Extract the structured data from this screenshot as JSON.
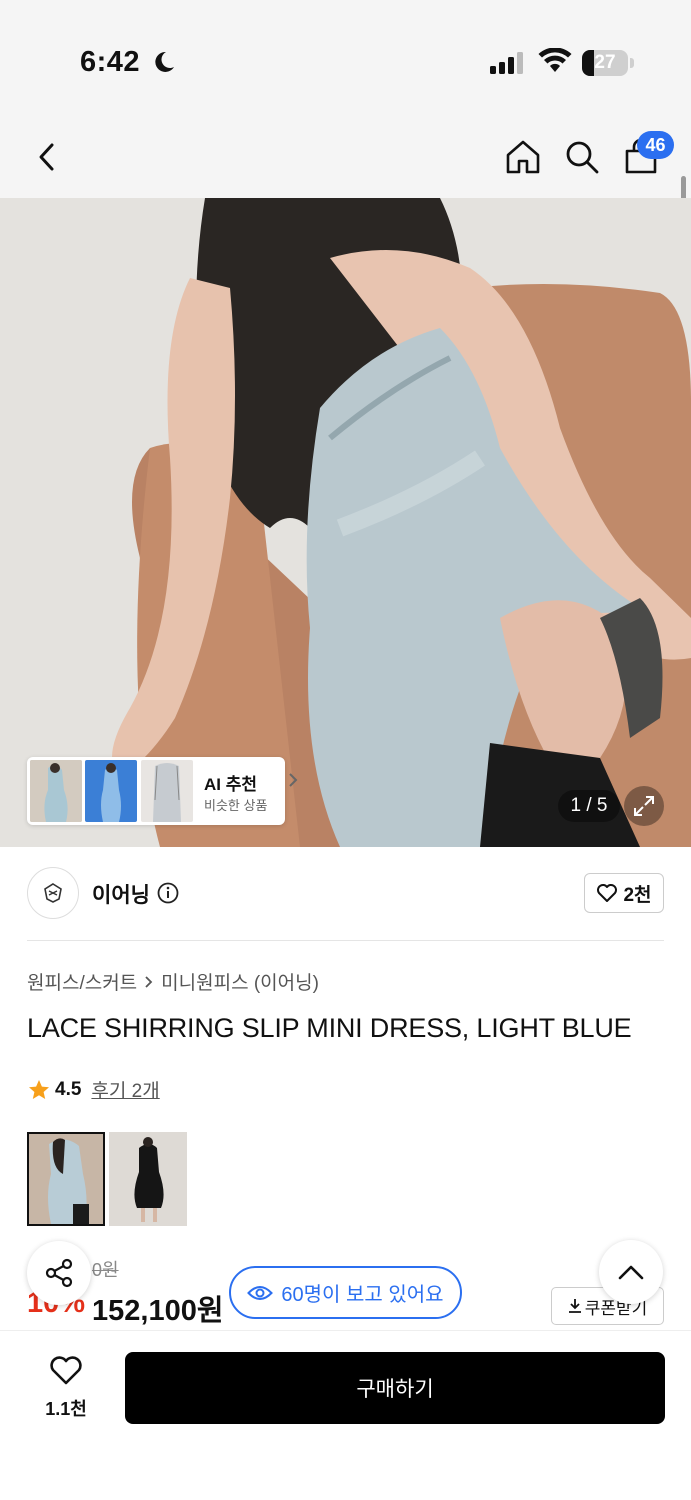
{
  "status_bar": {
    "time": "6:42",
    "battery": "27",
    "battery_level": 0.27
  },
  "nav": {
    "cart_count": "46",
    "icons": [
      "back-icon",
      "home-icon",
      "search-icon",
      "cart-icon"
    ]
  },
  "hero": {
    "counter": "1 / 5",
    "ai_card": {
      "title": "AI 추천",
      "subtitle": "비슷한 상품"
    }
  },
  "brand": {
    "name": "이어닝",
    "likes": "2천"
  },
  "breadcrumb": [
    "원피스/스커트",
    "미니원피스 (이어닝)"
  ],
  "product": {
    "title": "LACE SHIRRING SLIP MINI DRESS, LIGHT BLUE",
    "rating": "4.5",
    "reviews": "후기 2개",
    "price_original": "0원",
    "discount": "10%",
    "price": "152,100원"
  },
  "viewers": "60명이 보고 있어요",
  "coupon": "쿠폰받기",
  "bottom": {
    "wish_count": "1.1천",
    "buy_label": "구매하기"
  },
  "colors": {
    "accent": "#2b6ff0",
    "sale": "#e5301a",
    "buy_bg": "#000000"
  }
}
